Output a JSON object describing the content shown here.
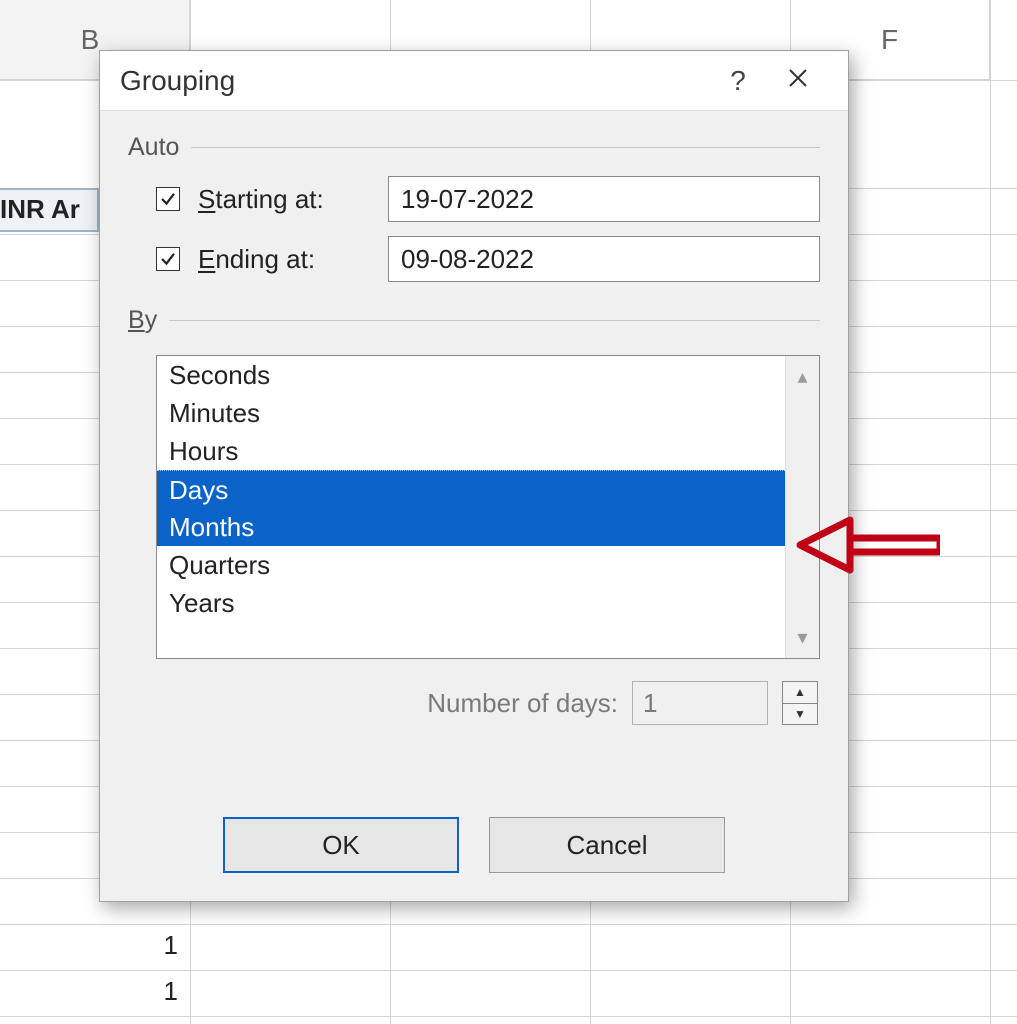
{
  "spreadsheet": {
    "columns": {
      "B": "B",
      "F": "F"
    },
    "cell_a3": "INR Ar",
    "row_value_1": "1",
    "row_value_2": "1"
  },
  "dialog": {
    "title": "Grouping",
    "help": "?",
    "close": "×",
    "auto_label": "Auto",
    "starting_label_pre": "S",
    "starting_label_post": "tarting at:",
    "ending_label_pre": "E",
    "ending_label_post": "nding at:",
    "starting_value": "19-07-2022",
    "ending_value": "09-08-2022",
    "starting_checked": "✓",
    "ending_checked": "✓",
    "by_label_pre": "B",
    "by_label_post": "y",
    "by_items": {
      "seconds": "Seconds",
      "minutes": "Minutes",
      "hours": "Hours",
      "days": "Days",
      "months": "Months",
      "quarters": "Quarters",
      "years": "Years"
    },
    "numdays_label": "Number of days:",
    "numdays_value": "1",
    "ok": "OK",
    "cancel": "Cancel"
  }
}
